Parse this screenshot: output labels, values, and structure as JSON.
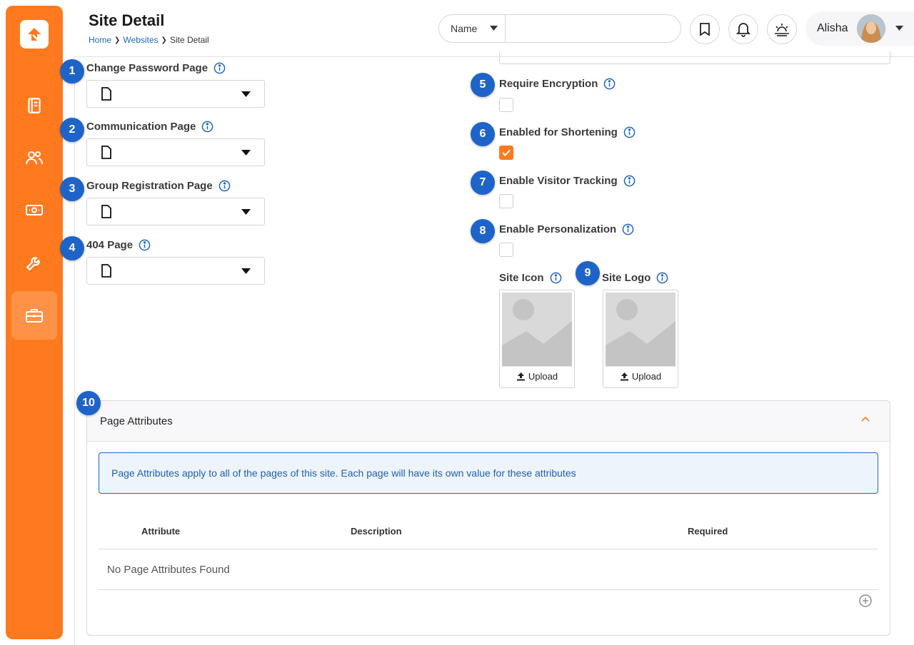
{
  "header": {
    "title": "Site Detail",
    "breadcrumb": [
      "Home",
      "Websites",
      "Site Detail"
    ],
    "search": {
      "select_value": "Name",
      "placeholder": ""
    },
    "user_name": "Alisha"
  },
  "sidebar": {
    "items": [
      {
        "icon": "book-icon",
        "active": false
      },
      {
        "icon": "people-icon",
        "active": false
      },
      {
        "icon": "money-icon",
        "active": false
      },
      {
        "icon": "wrench-icon",
        "active": false
      },
      {
        "icon": "briefcase-icon",
        "active": true
      }
    ]
  },
  "left_fields": [
    {
      "badge": "1",
      "label": "Change Password Page"
    },
    {
      "badge": "2",
      "label": "Communication Page"
    },
    {
      "badge": "3",
      "label": "Group Registration Page"
    },
    {
      "badge": "4",
      "label": "404 Page"
    }
  ],
  "right_fields": [
    {
      "badge": "5",
      "label": "Require Encryption",
      "checked": false
    },
    {
      "badge": "6",
      "label": "Enabled for Shortening",
      "checked": true
    },
    {
      "badge": "7",
      "label": "Enable Visitor Tracking",
      "checked": false
    },
    {
      "badge": "8",
      "label": "Enable Personalization",
      "checked": false
    }
  ],
  "images": {
    "badge": "9",
    "site_icon_label": "Site Icon",
    "site_logo_label": "Site Logo",
    "upload_label": "Upload"
  },
  "panel": {
    "badge": "10",
    "title": "Page Attributes",
    "alert": "Page Attributes apply to all of the pages of this site. Each page will have its own value for these attributes",
    "columns": [
      "Attribute",
      "Description",
      "Required"
    ],
    "empty_text": "No Page Attributes Found"
  },
  "colors": {
    "accent": "#ff7a1f",
    "badge": "#1e64c8",
    "link": "#1f67c1"
  }
}
